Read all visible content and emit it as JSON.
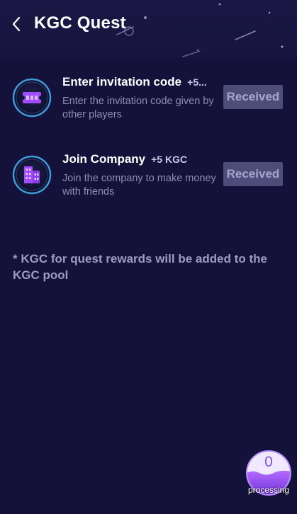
{
  "header": {
    "title": "KGC Quest"
  },
  "quests": [
    {
      "title": "Enter invitation code",
      "reward": "+5...",
      "description": "Enter the invitation code given by other players",
      "button_label": "Received",
      "icon": "ticket-icon"
    },
    {
      "title": "Join Company",
      "reward": "+5 KGC",
      "description": "Join the company to make money with friends",
      "button_label": "Received",
      "icon": "building-icon"
    }
  ],
  "note": "* KGC for quest rewards will be added to the KGC pool",
  "processing": {
    "count": "0",
    "label": "processing"
  },
  "colors": {
    "background": "#14123a",
    "button_bg": "#4d4d7a",
    "button_text": "#a5a6c9",
    "icon_accent": "#a24cff",
    "text_muted": "#8f8db3"
  }
}
